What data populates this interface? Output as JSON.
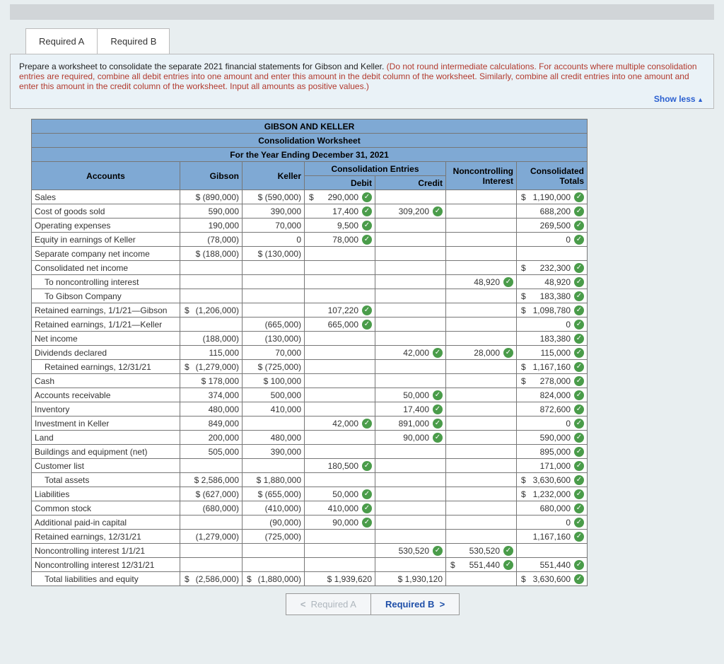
{
  "tabs": {
    "a": "Required A",
    "b": "Required B"
  },
  "instruction": {
    "black": "Prepare a worksheet to consolidate the separate 2021 financial statements for Gibson and Keller. ",
    "red": "(Do not round intermediate calculations. For accounts where multiple consolidation entries are required, combine all debit entries into one amount and enter this amount in the debit column of the worksheet. Similarly, combine all credit entries into one amount and enter this amount in the credit column of the worksheet. Input all amounts as positive values.)"
  },
  "showless": "Show less",
  "title1": "GIBSON AND KELLER",
  "title2": "Consolidation Worksheet",
  "title3": "For the Year Ending December 31, 2021",
  "head": {
    "consentries": "Consolidation Entries",
    "accounts": "Accounts",
    "gibson": "Gibson",
    "keller": "Keller",
    "debit": "Debit",
    "credit": "Credit",
    "nci": "Noncontrolling Interest",
    "totals": "Consolidated Totals"
  },
  "rows": [
    {
      "a": "Sales",
      "g": "$  (890,000)",
      "k": "$  (590,000)",
      "d": "290,000",
      "dC": 1,
      "dS": 1,
      "c": "",
      "t": "1,190,000",
      "tC": 1,
      "tS": 1
    },
    {
      "a": "Cost of goods sold",
      "g": "590,000",
      "k": "390,000",
      "d": "17,400",
      "dC": 1,
      "c": "309,200",
      "cC": 1,
      "t": "688,200",
      "tC": 1
    },
    {
      "a": "Operating expenses",
      "g": "190,000",
      "k": "70,000",
      "d": "9,500",
      "dC": 1,
      "t": "269,500",
      "tC": 1
    },
    {
      "a": "Equity in earnings of Keller",
      "g": "(78,000)",
      "k": "0",
      "d": "78,000",
      "dC": 1,
      "t": "0",
      "tC": 1
    },
    {
      "a": "Separate company net income",
      "g": "$  (188,000)",
      "k": "$  (130,000)"
    },
    {
      "a": "Consolidated net income",
      "t": "232,300",
      "tC": 1,
      "tS": 1
    },
    {
      "a": "To noncontrolling interest",
      "ind": 1,
      "n": "48,920",
      "nC": 1,
      "t": "48,920",
      "tC": 1
    },
    {
      "a": "To Gibson Company",
      "ind": 1,
      "t": "183,380",
      "tC": 1,
      "tS": 1
    },
    {
      "a": "Retained earnings, 1/1/21—Gibson",
      "g": "(1,206,000)",
      "gS": 1,
      "d": "107,220",
      "dC": 1,
      "t": "1,098,780",
      "tC": 1,
      "tS": 1
    },
    {
      "a": "Retained earnings, 1/1/21—Keller",
      "k": "(665,000)",
      "d": "665,000",
      "dC": 1,
      "t": "0",
      "tC": 1
    },
    {
      "a": "Net income",
      "g": "(188,000)",
      "k": "(130,000)",
      "t": "183,380",
      "tC": 1
    },
    {
      "a": "Dividends declared",
      "g": "115,000",
      "k": "70,000",
      "c": "42,000",
      "cC": 1,
      "n": "28,000",
      "nC": 1,
      "t": "115,000",
      "tC": 1
    },
    {
      "a": "Retained earnings, 12/31/21",
      "ind": 1,
      "g": "(1,279,000)",
      "gS": 1,
      "k": "$  (725,000)",
      "t": "1,167,160",
      "tC": 1,
      "tS": 1
    },
    {
      "a": "Cash",
      "g": "$    178,000",
      "k": "$    100,000",
      "t": "278,000",
      "tC": 1,
      "tS": 1
    },
    {
      "a": "Accounts receivable",
      "g": "374,000",
      "k": "500,000",
      "c": "50,000",
      "cC": 1,
      "t": "824,000",
      "tC": 1
    },
    {
      "a": "Inventory",
      "g": "480,000",
      "k": "410,000",
      "c": "17,400",
      "cC": 1,
      "t": "872,600",
      "tC": 1
    },
    {
      "a": "Investment in Keller",
      "g": "849,000",
      "d": "42,000",
      "dC": 1,
      "c": "891,000",
      "cC": 1,
      "t": "0",
      "tC": 1
    },
    {
      "a": "Land",
      "g": "200,000",
      "k": "480,000",
      "c": "90,000",
      "cC": 1,
      "t": "590,000",
      "tC": 1
    },
    {
      "a": "Buildings and equipment (net)",
      "g": "505,000",
      "k": "390,000",
      "t": "895,000",
      "tC": 1
    },
    {
      "a": "Customer list",
      "d": "180,500",
      "dC": 1,
      "t": "171,000",
      "tC": 1
    },
    {
      "a": "Total assets",
      "ind": 1,
      "g": "$ 2,586,000",
      "k": "$ 1,880,000",
      "t": "3,630,600",
      "tC": 1,
      "tS": 1
    },
    {
      "a": "Liabilities",
      "g": "$  (627,000)",
      "k": "$  (655,000)",
      "d": "50,000",
      "dC": 1,
      "t": "1,232,000",
      "tC": 1,
      "tS": 1
    },
    {
      "a": "Common stock",
      "g": "(680,000)",
      "k": "(410,000)",
      "d": "410,000",
      "dC": 1,
      "t": "680,000",
      "tC": 1
    },
    {
      "a": "Additional paid-in capital",
      "k": "(90,000)",
      "d": "90,000",
      "dC": 1,
      "t": "0",
      "tC": 1
    },
    {
      "a": "Retained earnings, 12/31/21",
      "g": "(1,279,000)",
      "k": "(725,000)",
      "t": "1,167,160",
      "tC": 1
    },
    {
      "a": "Noncontrolling interest 1/1/21",
      "c": "530,520",
      "cC": 1,
      "n": "530,520",
      "nC": 1
    },
    {
      "a": "Noncontrolling interest 12/31/21",
      "n": "551,440",
      "nC": 1,
      "nS": 1,
      "t": "551,440",
      "tC": 1
    },
    {
      "a": "Total liabilities and equity",
      "ind": 1,
      "g": "(2,586,000)",
      "gS": 1,
      "k": "(1,880,000)",
      "kS": 1,
      "d": "$ 1,939,620",
      "c": "$ 1,930,120",
      "t": "3,630,600",
      "tC": 1,
      "tS": 1
    }
  ],
  "nav": {
    "prev": "Required A",
    "next": "Required B"
  }
}
